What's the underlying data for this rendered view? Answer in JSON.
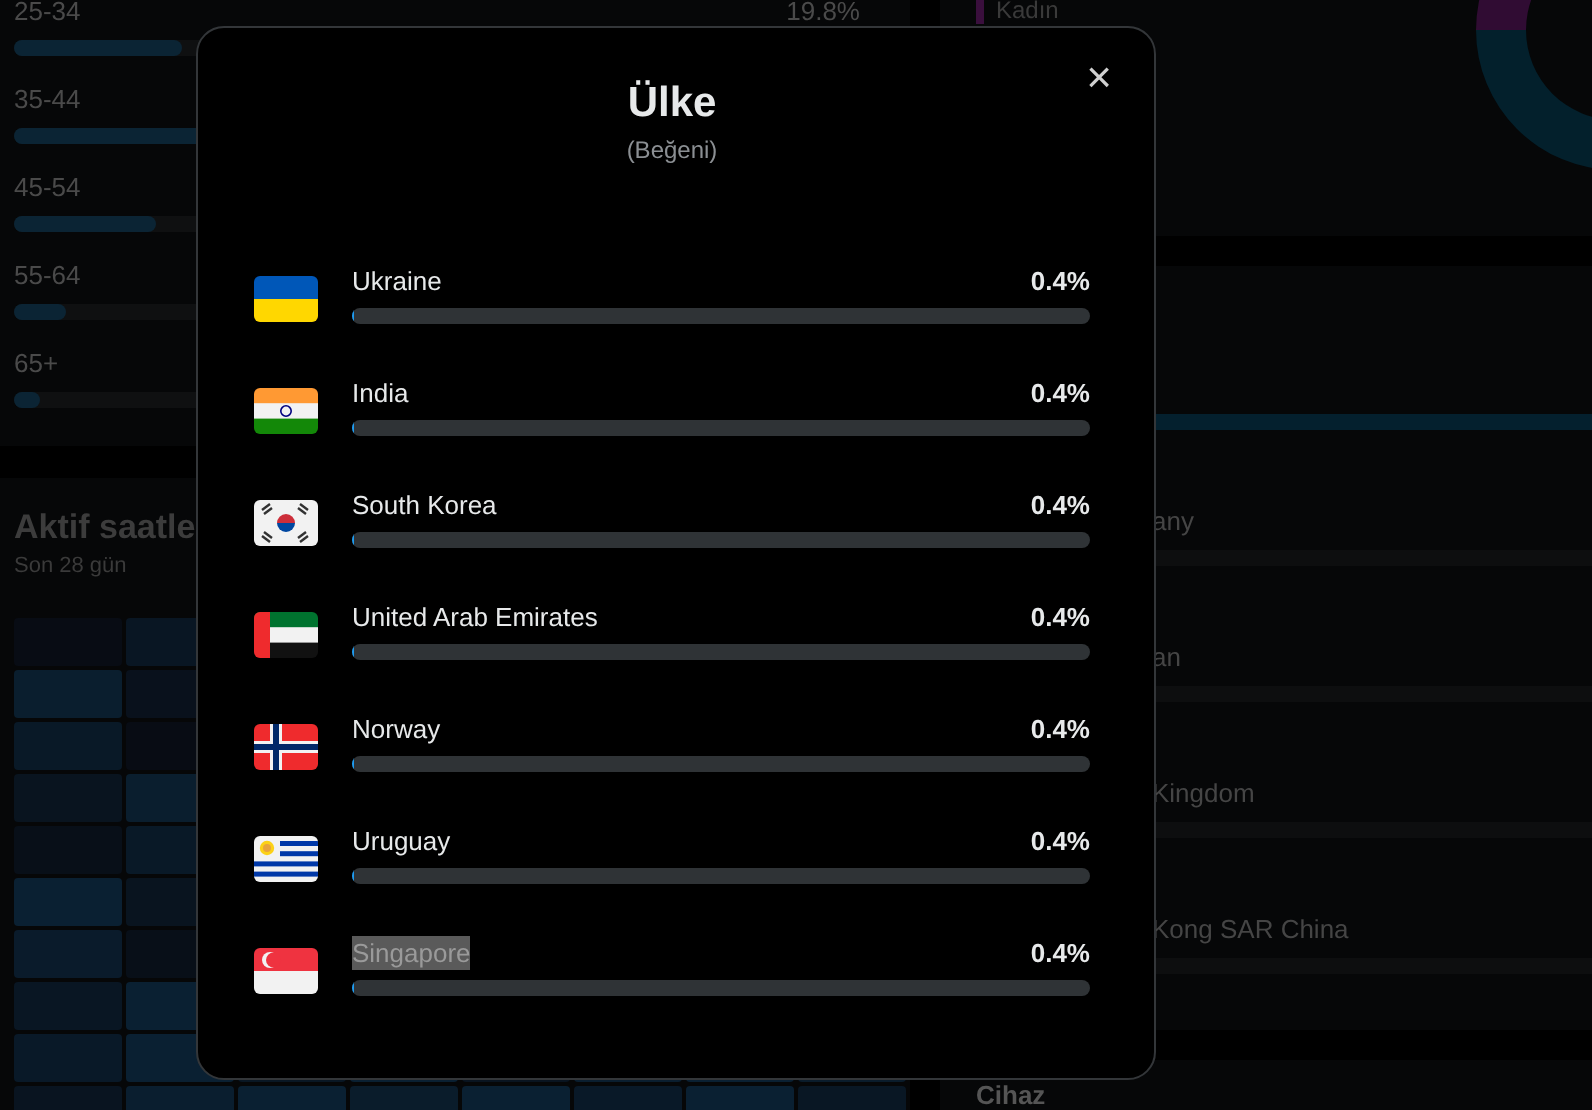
{
  "background": {
    "age_groups": [
      {
        "label": "25-34",
        "value": "19.8%",
        "level": 0.19
      },
      {
        "label": "35-44",
        "level": 0.3
      },
      {
        "label": "45-54",
        "level": 0.16
      },
      {
        "label": "55-64",
        "level": 0.06
      },
      {
        "label": "65+",
        "level": 0.03
      }
    ],
    "active_hours": {
      "title": "Aktif saatle",
      "subtitle": "Son 28 gün"
    },
    "gender_legend": [
      {
        "label": "Kadın",
        "color": "#3a0f3d"
      }
    ],
    "country_list": [
      {
        "level": 1.0
      },
      {
        "label": "any"
      },
      {
        "label": "an"
      },
      {
        "label": "Kingdom"
      },
      {
        "label": "Kong SAR China"
      }
    ],
    "device": {
      "title": "Cihaz"
    }
  },
  "modal": {
    "title": "Ülke",
    "subtitle": "(Beğeni)",
    "close": "×",
    "items": [
      {
        "kind": "ua",
        "name": "Ukraine",
        "value": "0.4%",
        "level": 0.004,
        "text_selected": false
      },
      {
        "kind": "in",
        "name": "India",
        "value": "0.4%",
        "level": 0.004,
        "text_selected": false
      },
      {
        "kind": "kr",
        "name": "South Korea",
        "value": "0.4%",
        "level": 0.004,
        "text_selected": false
      },
      {
        "kind": "ae",
        "name": "United Arab Emirates",
        "value": "0.4%",
        "level": 0.004,
        "text_selected": false
      },
      {
        "kind": "no",
        "name": "Norway",
        "value": "0.4%",
        "level": 0.004,
        "text_selected": false
      },
      {
        "kind": "uy",
        "name": "Uruguay",
        "value": "0.4%",
        "level": 0.004,
        "text_selected": false
      },
      {
        "kind": "sg",
        "name": "Singapore",
        "value": "0.4%",
        "level": 0.004,
        "text_selected": true
      }
    ]
  }
}
